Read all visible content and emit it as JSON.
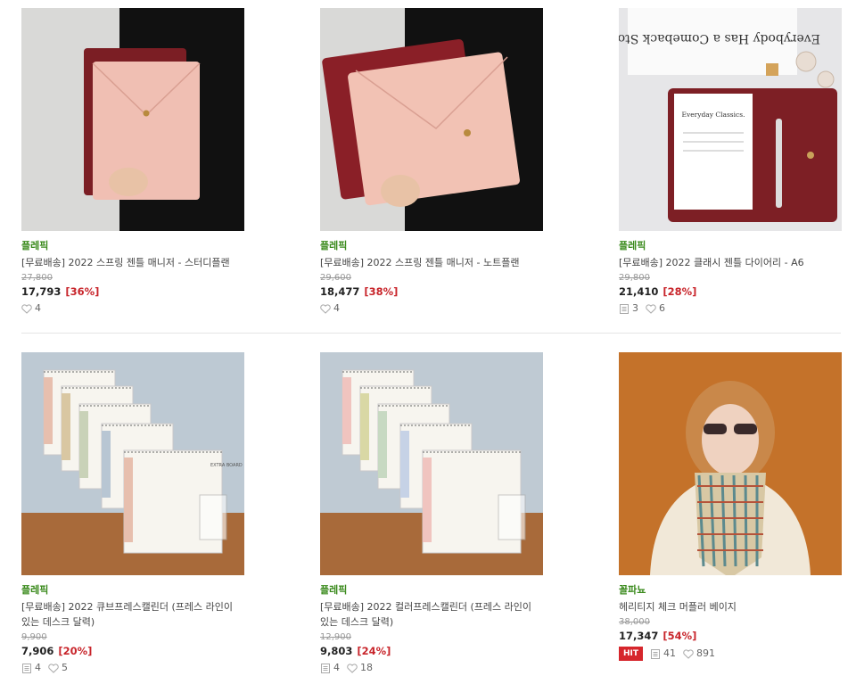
{
  "products": [
    {
      "brand": "플레픽",
      "title": "[무료배송] 2022 스프링 젠틀 매니저 - 스터디플랜",
      "original_price": "27,800",
      "price": "17,793",
      "discount": "[36%]",
      "reviews": null,
      "likes": "4",
      "hit": false,
      "image": {
        "bg": "#d9d9d7",
        "dark": "#111111",
        "primary": "#f0bfb3",
        "secondary": "#7b1e24",
        "skin": "#e8c2a6"
      }
    },
    {
      "brand": "플레픽",
      "title": "[무료배송] 2022 스프링 젠틀 매니저 - 노트플랜",
      "original_price": "29,600",
      "price": "18,477",
      "discount": "[38%]",
      "reviews": null,
      "likes": "4",
      "hit": false,
      "image": {
        "bg": "#d9d9d7",
        "dark": "#111111",
        "primary": "#f2c2b4",
        "secondary": "#8a1f27",
        "skin": "#e8c2a6"
      }
    },
    {
      "brand": "플레픽",
      "title": "[무료배송] 2022 클래시 젠틀 다이어리 - A6",
      "original_price": "29,800",
      "price": "21,410",
      "discount": "[28%]",
      "reviews": "3",
      "likes": "6",
      "hit": false,
      "image": {
        "bg": "#e6e6e8",
        "primary": "#7d1f25",
        "secondary": "#ffffff",
        "accent": "#c9a25a",
        "notebook_text": "Everyday Classics.",
        "magazine_text": "Everybody Has a Comeback Story"
      }
    },
    {
      "brand": "플레픽",
      "title": "[무료배송] 2022 큐브프레스캘린더 (프레스 라인이 있는 데스크 달력)",
      "original_price": "9,900",
      "price": "7,906",
      "discount": "[20%]",
      "reviews": "4",
      "likes": "5",
      "hit": false,
      "image": {
        "bg": "#bdc9d3",
        "table": "#a86a3a",
        "primary": "#f7f5ef",
        "accents": [
          "#e7bfae",
          "#d9c7a2",
          "#c9d2b8",
          "#b8c6d3"
        ],
        "calendar_text": "EXTRA BOARD"
      }
    },
    {
      "brand": "플레픽",
      "title": "[무료배송] 2022 컬러프레스캘린더 (프레스 라인이 있는 데스크 달력)",
      "original_price": "12,900",
      "price": "9,803",
      "discount": "[24%]",
      "reviews": "4",
      "likes": "18",
      "hit": false,
      "image": {
        "bg": "#bfcad3",
        "table": "#a86a3a",
        "primary": "#f7f5ef",
        "accents": [
          "#f0c4bf",
          "#d9d8a5",
          "#c7d9c2",
          "#c6d2e6"
        ]
      }
    },
    {
      "brand": "꼴파뇨",
      "title": "헤리티지 체크 머플러 베이지",
      "original_price": "38,000",
      "price": "17,347",
      "discount": "[54%]",
      "reviews": "41",
      "likes": "891",
      "hit": true,
      "hit_label": "HIT",
      "image": {
        "bg": "#c4722a",
        "hair": "#c9884a",
        "face": "#efd2c0",
        "sweater": "#f1e8d8",
        "scarf": [
          "#d8c8a4",
          "#5c8a8e",
          "#b5533a"
        ]
      }
    }
  ],
  "icons": {
    "review": "review-icon",
    "like": "heart-icon"
  }
}
